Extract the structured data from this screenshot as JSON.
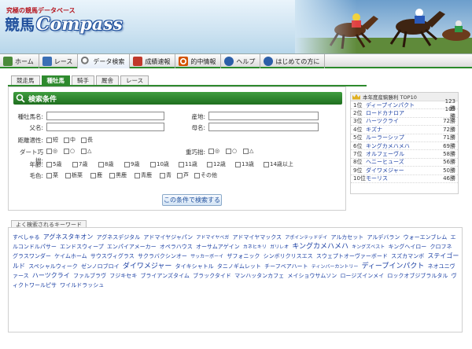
{
  "header": {
    "tagline": "究極の競馬データベース",
    "logo_jp": "競馬",
    "logo_en": "Compass"
  },
  "nav": [
    {
      "label": "ホーム",
      "icon": "house-icon",
      "color": "#4a8a3a"
    },
    {
      "label": "レース",
      "icon": "race-number-icon",
      "color": "#3a6fb5"
    },
    {
      "label": "データ検索",
      "icon": "magnifier-icon",
      "color": "#777777"
    },
    {
      "label": "成績速報",
      "icon": "pencil-icon",
      "color": "#c0392b"
    },
    {
      "label": "的中情報",
      "icon": "target-icon",
      "color": "#d35400"
    },
    {
      "label": "ヘルプ",
      "icon": "help-icon",
      "color": "#2c5fa8"
    },
    {
      "label": "はじめての方に",
      "icon": "info-icon",
      "color": "#2c5fa8"
    }
  ],
  "subtabs": [
    "競走馬",
    "種牡馬",
    "騎手",
    "厩舎",
    "レース"
  ],
  "search": {
    "title": "検索条件",
    "labels": {
      "stallion_name": "種牡馬名:",
      "father": "父名:",
      "distance": "距離適性:",
      "dirt": "ダート巧拙:",
      "age": "年齢:",
      "color": "毛色:",
      "origin": "産地:",
      "mother": "母名:",
      "heavy": "重巧拙:"
    },
    "distance_options": [
      "短",
      "中",
      "長"
    ],
    "skill_options": [
      "◎",
      "○",
      "△"
    ],
    "age_options": [
      "5歳",
      "7歳",
      "8歳",
      "9歳",
      "10歳",
      "11歳",
      "12歳",
      "13歳",
      "14歳以上"
    ],
    "color_options": [
      "栗",
      "栃栗",
      "鹿",
      "黒鹿",
      "青鹿",
      "青",
      "芦",
      "その他"
    ],
    "button": "この条件で検索する"
  },
  "ranking": {
    "title": "本年度産駒勝利 TOP10",
    "items": [
      {
        "rank": "1位",
        "name": "ディープインパクト",
        "count": "123勝"
      },
      {
        "rank": "2位",
        "name": "ロードカナロア",
        "count": "103勝"
      },
      {
        "rank": "3位",
        "name": "ハーツクライ",
        "count": "72勝"
      },
      {
        "rank": "4位",
        "name": "キズナ",
        "count": "72勝"
      },
      {
        "rank": "5位",
        "name": "ルーラーシップ",
        "count": "71勝"
      },
      {
        "rank": "6位",
        "name": "キングカメハメハ",
        "count": "69勝"
      },
      {
        "rank": "7位",
        "name": "オルフェーヴル",
        "count": "58勝"
      },
      {
        "rank": "8位",
        "name": "ヘニーヒューズ",
        "count": "56勝"
      },
      {
        "rank": "9位",
        "name": "ダイワメジャー",
        "count": "50勝"
      },
      {
        "rank": "10位",
        "name": "モーリス",
        "count": "46勝"
      }
    ]
  },
  "keywords": {
    "title": "よく検索されるキーワード",
    "items": [
      {
        "t": "すべしゃる",
        "s": ""
      },
      {
        "t": "アグネスタキオン",
        "s": "mid"
      },
      {
        "t": "アグネスデジタル",
        "s": ""
      },
      {
        "t": "アドマイヤジャパン",
        "s": ""
      },
      {
        "t": "アドマイヤベガ",
        "s": "sm"
      },
      {
        "t": "アドマイヤマックス",
        "s": ""
      },
      {
        "t": "アポインテッドデイ",
        "s": "sm"
      },
      {
        "t": "アルカセット",
        "s": ""
      },
      {
        "t": "アルデバラン",
        "s": ""
      },
      {
        "t": "ウォーエンブレム",
        "s": ""
      },
      {
        "t": "エルコンドルパサー",
        "s": ""
      },
      {
        "t": "エンドスウィープ",
        "s": ""
      },
      {
        "t": "エンパイアメーカー",
        "s": ""
      },
      {
        "t": "オペラハウス",
        "s": ""
      },
      {
        "t": "オーサムアゲイン",
        "s": ""
      },
      {
        "t": "カネヒキリ",
        "s": "sm"
      },
      {
        "t": "ガリレオ",
        "s": "sm"
      },
      {
        "t": "キングカメハメハ",
        "s": "big"
      },
      {
        "t": "キングズベスト",
        "s": "sm"
      },
      {
        "t": "キングヘイロー",
        "s": ""
      },
      {
        "t": "クロフネ",
        "s": ""
      },
      {
        "t": "グラスワンダー",
        "s": ""
      },
      {
        "t": "ケイムホーム",
        "s": ""
      },
      {
        "t": "サウスヴィグラス",
        "s": ""
      },
      {
        "t": "サクラバクシンオー",
        "s": ""
      },
      {
        "t": "サッカーボーイ",
        "s": "sm"
      },
      {
        "t": "ザフォニック",
        "s": ""
      },
      {
        "t": "シンボリクリスエス",
        "s": ""
      },
      {
        "t": "スウェプトオーヴァーボード",
        "s": ""
      },
      {
        "t": "スズカマンボ",
        "s": ""
      },
      {
        "t": "ステイゴールド",
        "s": "mid"
      },
      {
        "t": "スペシャルウィーク",
        "s": ""
      },
      {
        "t": "ゼンノロブロイ",
        "s": ""
      },
      {
        "t": "ダイワメジャー",
        "s": "big"
      },
      {
        "t": "タイキシャトル",
        "s": ""
      },
      {
        "t": "タニノギムレット",
        "s": ""
      },
      {
        "t": "チーフベアハート",
        "s": ""
      },
      {
        "t": "ティンバーカントリー",
        "s": "sm"
      },
      {
        "t": "ディープインパクト",
        "s": "big"
      },
      {
        "t": "ネオユニヴァース",
        "s": ""
      },
      {
        "t": "ハーツクライ",
        "s": "mid"
      },
      {
        "t": "ファルブラヴ",
        "s": ""
      },
      {
        "t": "フジキセキ",
        "s": ""
      },
      {
        "t": "ブライアンズタイム",
        "s": ""
      },
      {
        "t": "ブラックタイド",
        "s": ""
      },
      {
        "t": "マンハッタンカフェ",
        "s": ""
      },
      {
        "t": "メイショウサムソン",
        "s": ""
      },
      {
        "t": "ロージズインメイ",
        "s": ""
      },
      {
        "t": "ロックオブジブラルタル",
        "s": ""
      },
      {
        "t": "ヴィクトワールピサ",
        "s": ""
      },
      {
        "t": "ワイルドラッシュ",
        "s": ""
      }
    ]
  }
}
